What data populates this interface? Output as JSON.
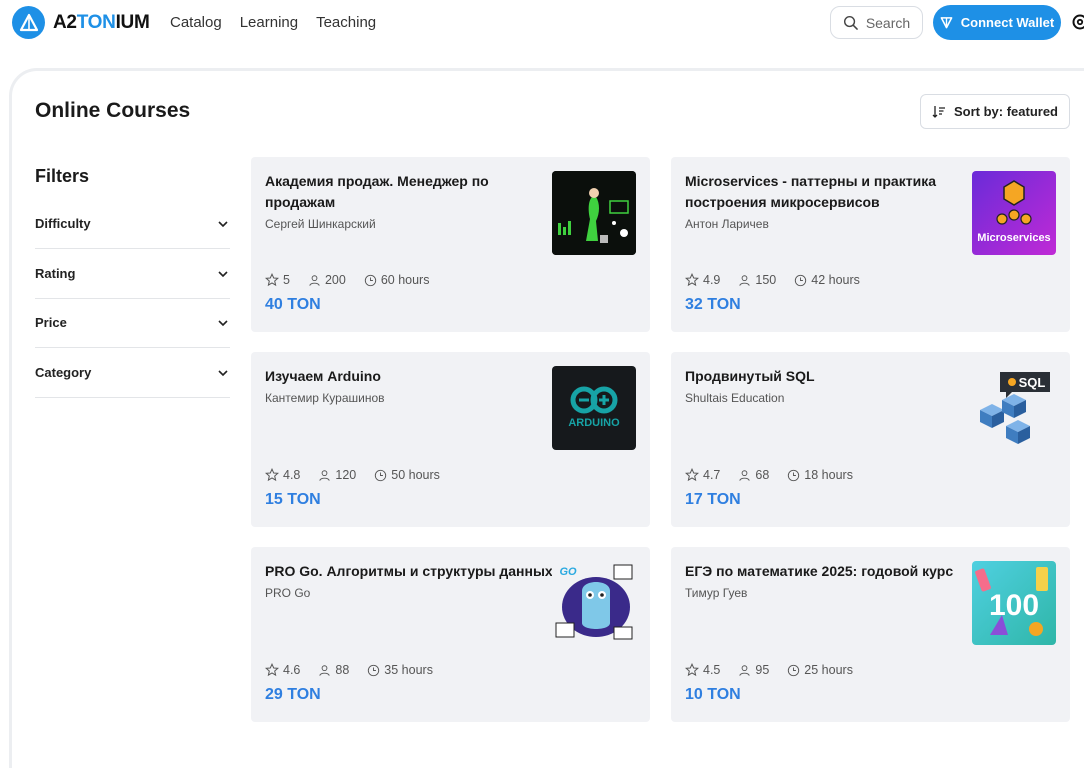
{
  "brand": {
    "part_a": "A2",
    "part_b": "TON",
    "part_c": "IUM"
  },
  "nav": {
    "catalog": "Catalog",
    "learning": "Learning",
    "teaching": "Teaching"
  },
  "header": {
    "search_label": "Search",
    "wallet_label": "Connect Wallet"
  },
  "page": {
    "title": "Online Courses",
    "sort_label": "Sort by: featured"
  },
  "filters": {
    "title": "Filters",
    "items": [
      "Difficulty",
      "Rating",
      "Price",
      "Category"
    ]
  },
  "courses": [
    {
      "title": "Академия продаж. Менеджер по продажам",
      "author": "Сергей Шинкарский",
      "rating": "5",
      "students": "200",
      "duration": "60 hours",
      "price": "40 TON"
    },
    {
      "title": "Microservices - паттерны и практика построения микросервисов",
      "author": "Антон Ларичев",
      "rating": "4.9",
      "students": "150",
      "duration": "42 hours",
      "price": "32 TON",
      "thumb_text": "Microservices"
    },
    {
      "title": "Изучаем Arduino",
      "author": "Кантемир Курашинов",
      "rating": "4.8",
      "students": "120",
      "duration": "50 hours",
      "price": "15 TON",
      "thumb_text": "ARDUINO"
    },
    {
      "title": "Продвинутый SQL",
      "author": "Shultais Education",
      "rating": "4.7",
      "students": "68",
      "duration": "18 hours",
      "price": "17 TON",
      "thumb_text": "SQL"
    },
    {
      "title": "PRO Go. Алгоритмы и структуры данных",
      "author": "PRO Go",
      "rating": "4.6",
      "students": "88",
      "duration": "35 hours",
      "price": "29 TON",
      "thumb_text": "GO"
    },
    {
      "title": "ЕГЭ по математике 2025: годовой курс",
      "author": "Тимур Гуев",
      "rating": "4.5",
      "students": "95",
      "duration": "25 hours",
      "price": "10 TON",
      "thumb_text": "100"
    }
  ],
  "colors": {
    "accent": "#1e90e6",
    "price": "#2f7fe0",
    "card_bg": "#f1f2f5"
  }
}
